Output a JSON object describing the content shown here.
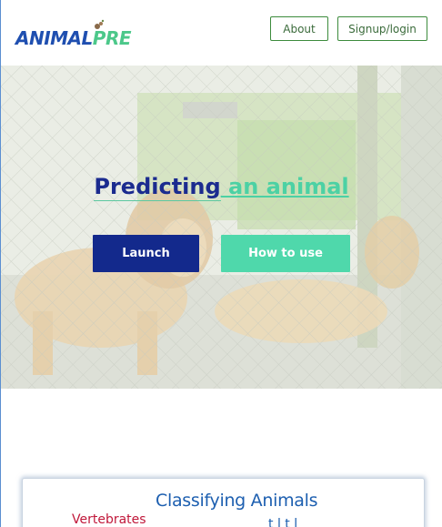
{
  "header": {
    "logo": {
      "part1": "ANIMAL",
      "part2": "PRE"
    },
    "nav": [
      {
        "label": "About"
      },
      {
        "label": "Signup/login"
      }
    ]
  },
  "hero": {
    "title_part1": "Predicting",
    "title_part2": " an animal",
    "buttons": {
      "launch": "Launch",
      "how_to_use": "How to use"
    }
  },
  "card": {
    "title": "Classifying Animals",
    "subtitle": "Vertebrates",
    "partial_text": "t     l   t  l"
  },
  "colors": {
    "brand_blue": "#13298c",
    "accent_green": "#4fd8ab",
    "nav_border": "#3c8b3c"
  }
}
